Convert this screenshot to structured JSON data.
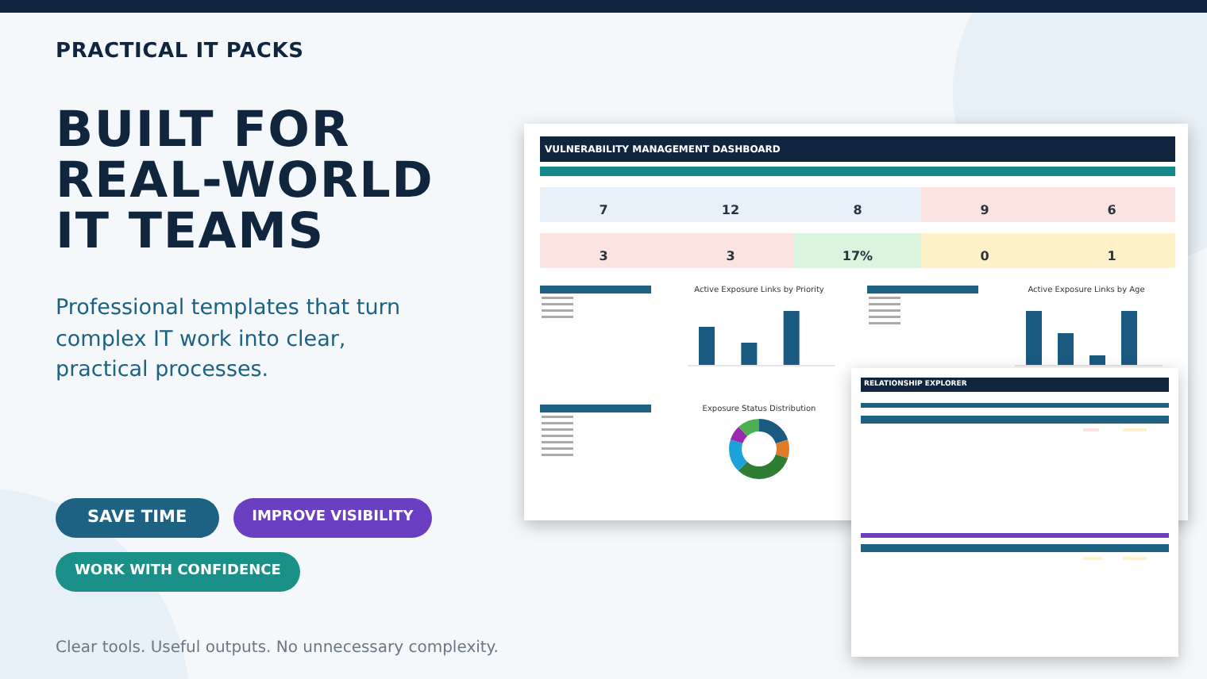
{
  "brand": "PRACTICAL IT PACKS",
  "headline": [
    "BUILT FOR",
    "REAL-WORLD",
    "IT TEAMS"
  ],
  "description": "Professional templates that turn complex IT work into clear, practical processes.",
  "pills": [
    {
      "label": "SAVE TIME",
      "color": "#1d6283"
    },
    {
      "label": "IMPROVE VISIBILITY",
      "color": "#6a3fc2"
    },
    {
      "label": "WORK WITH CONFIDENCE",
      "color": "#1a9088"
    }
  ],
  "footer": "Clear tools. Useful outputs. No unnecessary complexity.",
  "dashboard": {
    "title": "VULNERABILITY MANAGEMENT DASHBOARD",
    "kpis": [
      [
        {
          "value": "7",
          "color": "#e8f1fa"
        },
        {
          "value": "12",
          "color": "#e8f1fa"
        },
        {
          "value": "8",
          "color": "#e8f1fa"
        },
        {
          "value": "9",
          "color": "#fde2e2"
        },
        {
          "value": "6",
          "color": "#fde2e2"
        }
      ],
      [
        {
          "value": "3",
          "color": "#fde2e2"
        },
        {
          "value": "3",
          "color": "#fde2e2"
        },
        {
          "value": "17%",
          "color": "#d9f5dd"
        },
        {
          "value": "0",
          "color": "#fff1c7"
        },
        {
          "value": "1",
          "color": "#fff1c7"
        }
      ]
    ],
    "priority_chart_title": "Active Exposure Links by Priority",
    "age_chart_title": "Active Exposure Links by Age",
    "status_chart_title": "Exposure Status Distribution"
  },
  "explorer": {
    "title": "RELATIONSHIP EXPLORER"
  }
}
